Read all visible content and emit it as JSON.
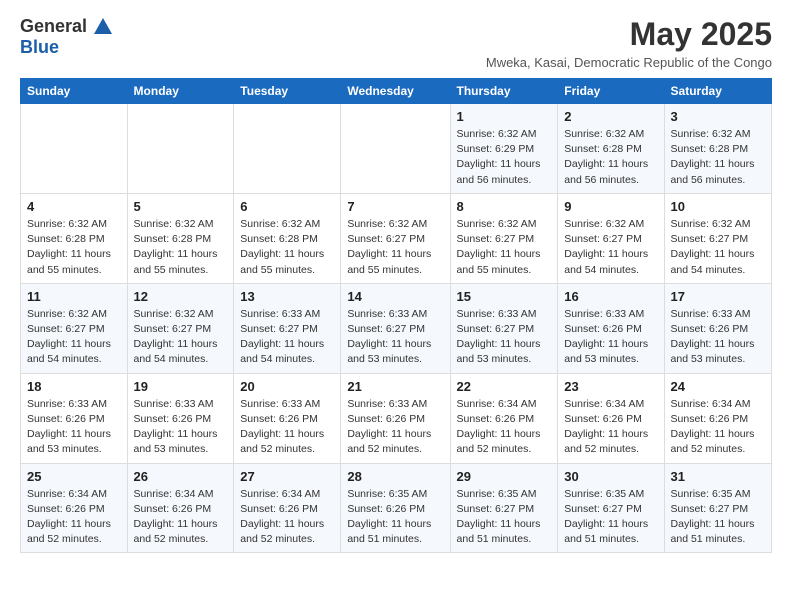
{
  "logo": {
    "general": "General",
    "blue": "Blue"
  },
  "header": {
    "month_year": "May 2025",
    "location": "Mweka, Kasai, Democratic Republic of the Congo"
  },
  "days_of_week": [
    "Sunday",
    "Monday",
    "Tuesday",
    "Wednesday",
    "Thursday",
    "Friday",
    "Saturday"
  ],
  "weeks": [
    [
      {
        "day": "",
        "info": ""
      },
      {
        "day": "",
        "info": ""
      },
      {
        "day": "",
        "info": ""
      },
      {
        "day": "",
        "info": ""
      },
      {
        "day": "1",
        "info": "Sunrise: 6:32 AM\nSunset: 6:29 PM\nDaylight: 11 hours and 56 minutes."
      },
      {
        "day": "2",
        "info": "Sunrise: 6:32 AM\nSunset: 6:28 PM\nDaylight: 11 hours and 56 minutes."
      },
      {
        "day": "3",
        "info": "Sunrise: 6:32 AM\nSunset: 6:28 PM\nDaylight: 11 hours and 56 minutes."
      }
    ],
    [
      {
        "day": "4",
        "info": "Sunrise: 6:32 AM\nSunset: 6:28 PM\nDaylight: 11 hours and 55 minutes."
      },
      {
        "day": "5",
        "info": "Sunrise: 6:32 AM\nSunset: 6:28 PM\nDaylight: 11 hours and 55 minutes."
      },
      {
        "day": "6",
        "info": "Sunrise: 6:32 AM\nSunset: 6:28 PM\nDaylight: 11 hours and 55 minutes."
      },
      {
        "day": "7",
        "info": "Sunrise: 6:32 AM\nSunset: 6:27 PM\nDaylight: 11 hours and 55 minutes."
      },
      {
        "day": "8",
        "info": "Sunrise: 6:32 AM\nSunset: 6:27 PM\nDaylight: 11 hours and 55 minutes."
      },
      {
        "day": "9",
        "info": "Sunrise: 6:32 AM\nSunset: 6:27 PM\nDaylight: 11 hours and 54 minutes."
      },
      {
        "day": "10",
        "info": "Sunrise: 6:32 AM\nSunset: 6:27 PM\nDaylight: 11 hours and 54 minutes."
      }
    ],
    [
      {
        "day": "11",
        "info": "Sunrise: 6:32 AM\nSunset: 6:27 PM\nDaylight: 11 hours and 54 minutes."
      },
      {
        "day": "12",
        "info": "Sunrise: 6:32 AM\nSunset: 6:27 PM\nDaylight: 11 hours and 54 minutes."
      },
      {
        "day": "13",
        "info": "Sunrise: 6:33 AM\nSunset: 6:27 PM\nDaylight: 11 hours and 54 minutes."
      },
      {
        "day": "14",
        "info": "Sunrise: 6:33 AM\nSunset: 6:27 PM\nDaylight: 11 hours and 53 minutes."
      },
      {
        "day": "15",
        "info": "Sunrise: 6:33 AM\nSunset: 6:27 PM\nDaylight: 11 hours and 53 minutes."
      },
      {
        "day": "16",
        "info": "Sunrise: 6:33 AM\nSunset: 6:26 PM\nDaylight: 11 hours and 53 minutes."
      },
      {
        "day": "17",
        "info": "Sunrise: 6:33 AM\nSunset: 6:26 PM\nDaylight: 11 hours and 53 minutes."
      }
    ],
    [
      {
        "day": "18",
        "info": "Sunrise: 6:33 AM\nSunset: 6:26 PM\nDaylight: 11 hours and 53 minutes."
      },
      {
        "day": "19",
        "info": "Sunrise: 6:33 AM\nSunset: 6:26 PM\nDaylight: 11 hours and 53 minutes."
      },
      {
        "day": "20",
        "info": "Sunrise: 6:33 AM\nSunset: 6:26 PM\nDaylight: 11 hours and 52 minutes."
      },
      {
        "day": "21",
        "info": "Sunrise: 6:33 AM\nSunset: 6:26 PM\nDaylight: 11 hours and 52 minutes."
      },
      {
        "day": "22",
        "info": "Sunrise: 6:34 AM\nSunset: 6:26 PM\nDaylight: 11 hours and 52 minutes."
      },
      {
        "day": "23",
        "info": "Sunrise: 6:34 AM\nSunset: 6:26 PM\nDaylight: 11 hours and 52 minutes."
      },
      {
        "day": "24",
        "info": "Sunrise: 6:34 AM\nSunset: 6:26 PM\nDaylight: 11 hours and 52 minutes."
      }
    ],
    [
      {
        "day": "25",
        "info": "Sunrise: 6:34 AM\nSunset: 6:26 PM\nDaylight: 11 hours and 52 minutes."
      },
      {
        "day": "26",
        "info": "Sunrise: 6:34 AM\nSunset: 6:26 PM\nDaylight: 11 hours and 52 minutes."
      },
      {
        "day": "27",
        "info": "Sunrise: 6:34 AM\nSunset: 6:26 PM\nDaylight: 11 hours and 52 minutes."
      },
      {
        "day": "28",
        "info": "Sunrise: 6:35 AM\nSunset: 6:26 PM\nDaylight: 11 hours and 51 minutes."
      },
      {
        "day": "29",
        "info": "Sunrise: 6:35 AM\nSunset: 6:27 PM\nDaylight: 11 hours and 51 minutes."
      },
      {
        "day": "30",
        "info": "Sunrise: 6:35 AM\nSunset: 6:27 PM\nDaylight: 11 hours and 51 minutes."
      },
      {
        "day": "31",
        "info": "Sunrise: 6:35 AM\nSunset: 6:27 PM\nDaylight: 11 hours and 51 minutes."
      }
    ]
  ]
}
